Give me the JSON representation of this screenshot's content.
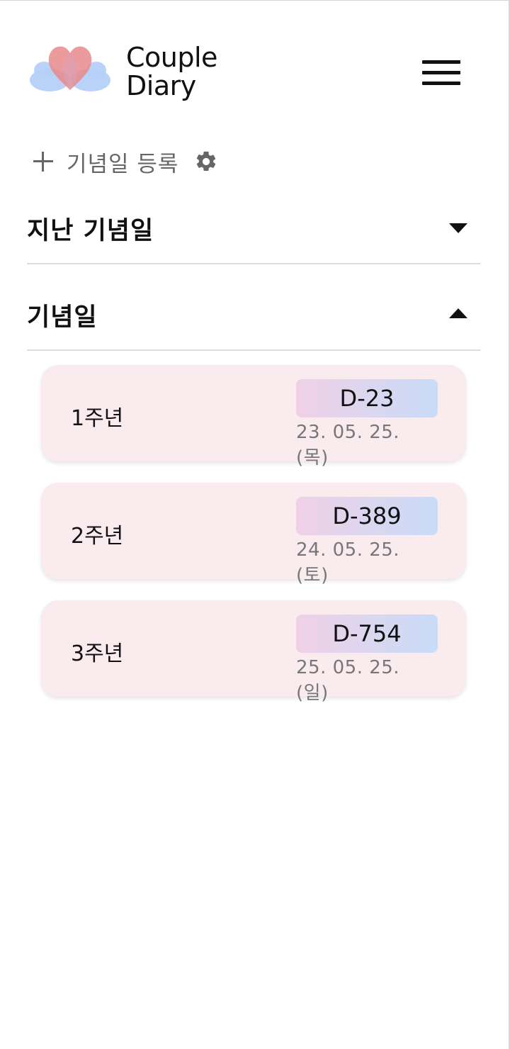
{
  "header": {
    "logo_line1": "Couple",
    "logo_line2": "Diary"
  },
  "actions": {
    "add_label": "기념일 등록"
  },
  "sections": {
    "past_title": "지난 기념일",
    "upcoming_title": "기념일"
  },
  "anniversaries": [
    {
      "name": "1주년",
      "dday": "D-23",
      "date": "23. 05. 25.(목)"
    },
    {
      "name": "2주년",
      "dday": "D-389",
      "date": "24. 05. 25.(토)"
    },
    {
      "name": "3주년",
      "dday": "D-754",
      "date": "25. 05. 25.(일)"
    }
  ],
  "icons": {
    "logo": "heart-clouds-logo-icon",
    "menu": "hamburger-menu-icon",
    "add": "plus-icon",
    "settings": "gear-icon",
    "past_toggle": "caret-down-icon",
    "upcoming_toggle": "caret-up-icon"
  },
  "colors": {
    "card_bg": "#faebee",
    "badge_gradient_start": "#f0d0e6",
    "badge_gradient_end": "#c8dcf8",
    "logo_heart": "#e88a8a",
    "logo_cloud": "#b5d0f7"
  }
}
